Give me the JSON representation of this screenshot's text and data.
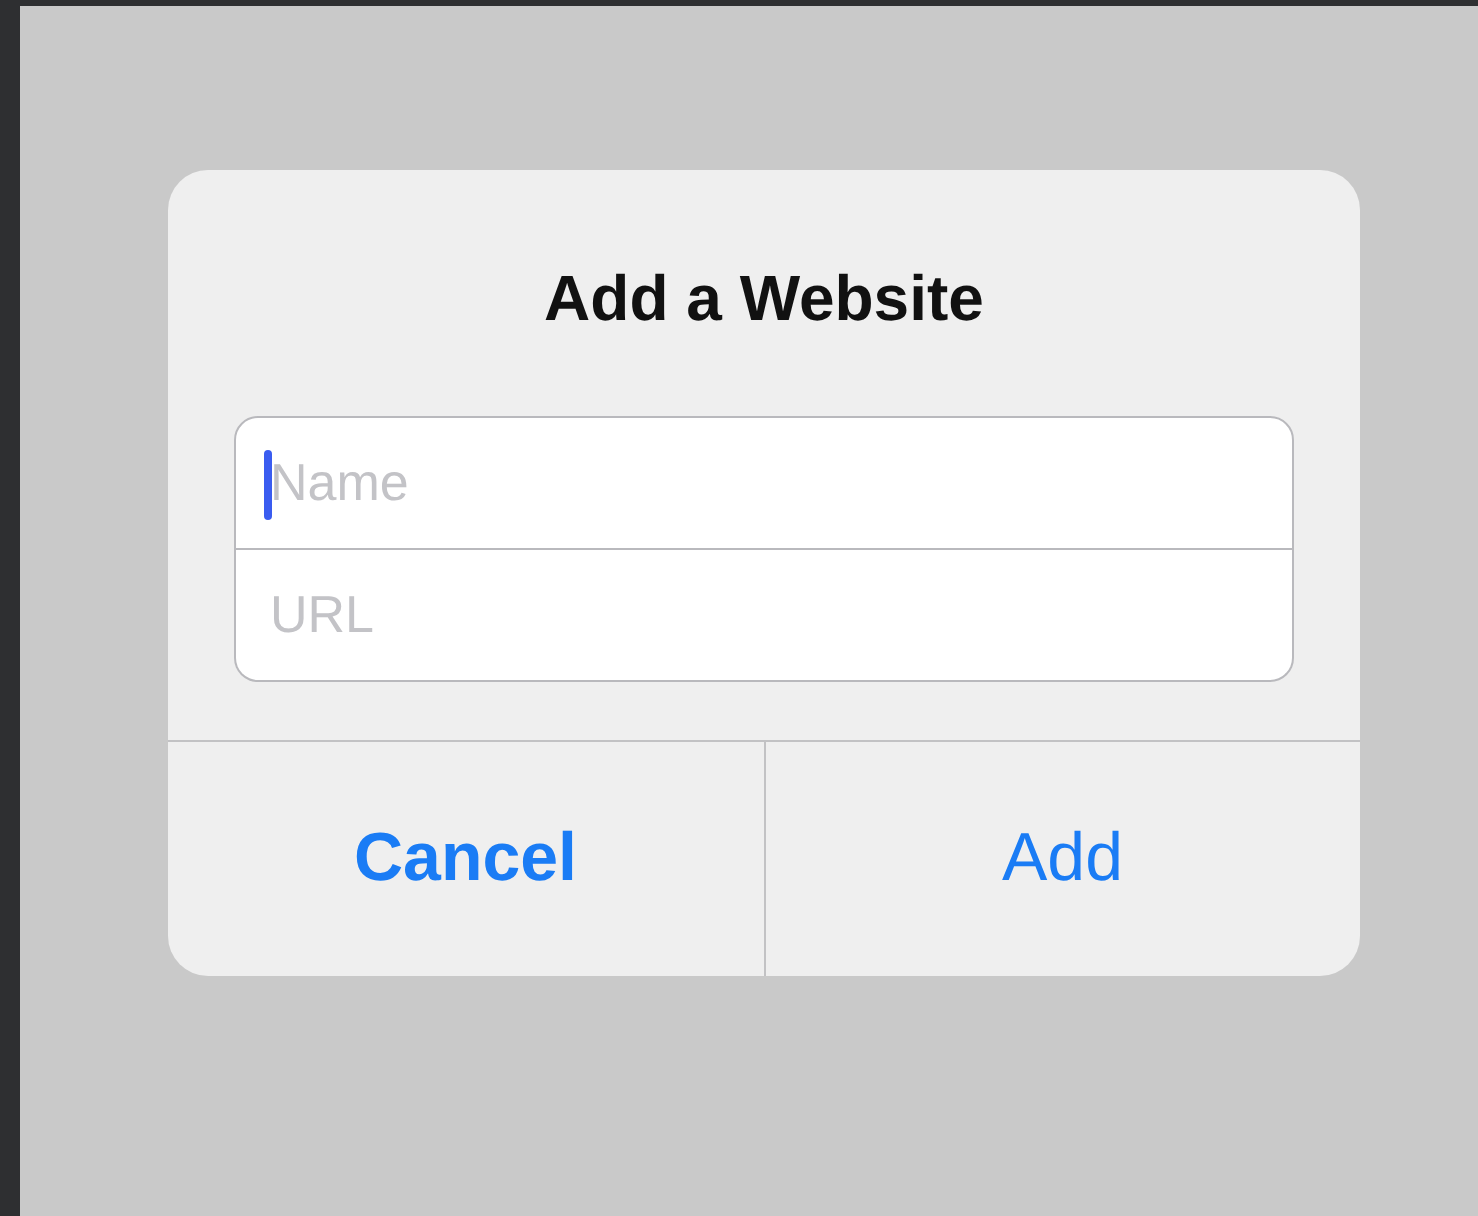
{
  "dialog": {
    "title": "Add a Website",
    "fields": [
      {
        "placeholder": "Name",
        "focused": true
      },
      {
        "placeholder": "URL",
        "focused": false
      }
    ],
    "buttons": [
      {
        "label": "Cancel",
        "emphasized": true
      },
      {
        "label": "Add",
        "emphasized": false
      }
    ]
  }
}
